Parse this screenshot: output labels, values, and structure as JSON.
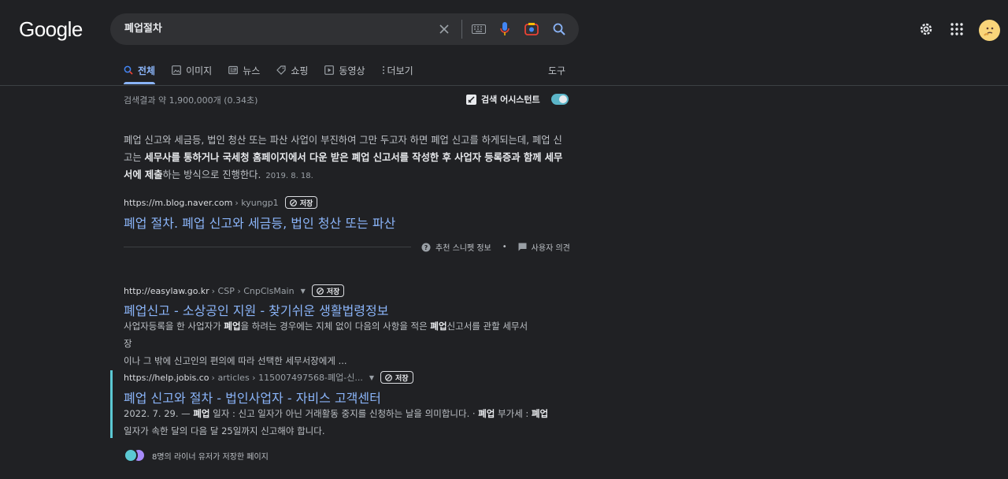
{
  "header": {
    "logo": "Google",
    "search_value": "폐업절차"
  },
  "tabs": [
    {
      "label": "전체",
      "icon": "search-icon",
      "active": true
    },
    {
      "label": "이미지",
      "icon": "image-icon"
    },
    {
      "label": "뉴스",
      "icon": "news-icon"
    },
    {
      "label": "쇼핑",
      "icon": "tag-icon"
    },
    {
      "label": "동영상",
      "icon": "play-icon"
    },
    {
      "label": "더보기",
      "icon": "more-vert-icon"
    }
  ],
  "tools_label": "도구",
  "result_stats": "검색결과 약 1,900,000개 (0.34초)",
  "assistant_label": "검색 어시스턴트",
  "featured": {
    "text_1": "폐업 신고와 세금등, 법인 청산 또는 파산 사업이 부진하여 그만 두고자 하면 폐업 신고를 하게되는데, 폐업 신고는 ",
    "bold_1": "세무사를 통하거나 국세청 홈페이지에서 다운 받은 폐업 신고서를 작성한 후 사업자 등록증과 함께 세무서에 제출",
    "text_2": "하는 방식으로 진행한다.",
    "date": "2019. 8. 18.",
    "site": "https://m.blog.naver.com",
    "path": "› kyungp1",
    "save": "저장",
    "title": "폐업 절차. 폐업 신고와 세금등, 법인 청산 또는 파산",
    "about": "추천 스니펫 정보",
    "feedback": "사용자 의견"
  },
  "results": [
    {
      "site": "http://easylaw.go.kr",
      "path": "› CSP › CnpClsMain",
      "save": "저장",
      "title": "폐업신고 - 소상공인 지원 - 찾기쉬운 생활법령정보",
      "d1": "사업자등록을 한 사업자가 ",
      "d1b": "폐업",
      "d2": "을 하려는 경우에는 지체 없이 다음의 사항을 적은 ",
      "d2b": "폐업",
      "d3": "신고서를 관할 세무서장",
      "line2": "이나 그 밖에 신고인의 편의에 따라 선택한 세무서장에게 ..."
    },
    {
      "site": "https://help.jobis.co",
      "path": "› articles › 115007497568-폐업-신...",
      "save": "저장",
      "title": "폐업 신고와 절차 - 법인사업자 - 자비스 고객센터",
      "d1": "2022. 7. 29. — ",
      "d1b": "폐업",
      "d2": " 일자 : 신고 일자가 아닌 거래활동 중지를 신청하는 날을 의미합니다. · ",
      "d2b": "폐업",
      "d3": " 부가세 : ",
      "d3b": "폐업",
      "line2": "일자가 속한 달의 다음 달 25일까지 신고해야 합니다."
    }
  ],
  "people_text": "8명의 라이너 유저가 저장한 페이지",
  "colors": {
    "link": "#8ab4f8",
    "accent": "#5bc8d3",
    "bg": "#202124"
  }
}
